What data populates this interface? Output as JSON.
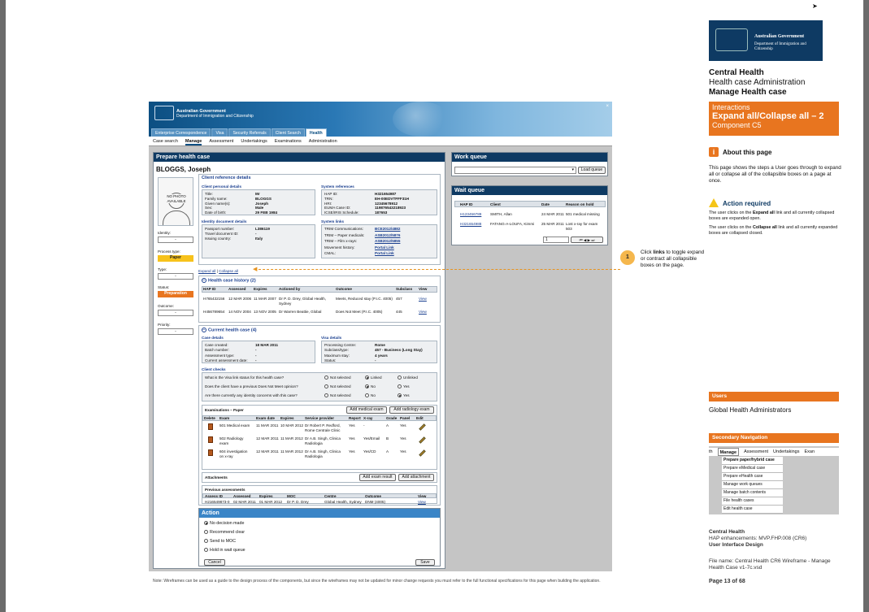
{
  "header": {
    "gov_line1": "Australian Government",
    "gov_line2": "Department of Immigration and Citizenship",
    "top_tabs": [
      "Enterprise Correspondence",
      "Visa",
      "Security Referrals",
      "Client Search",
      "Health"
    ],
    "sub_tabs": [
      "Case search",
      "Manage",
      "Assessment",
      "Undertakings",
      "Examinations",
      "Administration"
    ]
  },
  "prepare": {
    "title": "Prepare health case",
    "client_name": "BLOGGS, Joseph",
    "photo_text": "NO PHOTO AVAILABLE",
    "identity_label": "Identity:",
    "identity_value": "-",
    "process_type_label": "Process type:",
    "process_type_value": "Paper",
    "type_label": "Type:",
    "type_value": "-",
    "status_label": "Status:",
    "status_value": "Preparation",
    "outcome_label": "Outcome:",
    "outcome_value": "-",
    "priority_label": "Priority:",
    "priority_value": "-",
    "client_ref_title": "Client reference details",
    "client_personal_title": "Client personal details",
    "personal": [
      {
        "label": "Title:",
        "value": "Mr"
      },
      {
        "label": "Family name:",
        "value": "BLOGGS"
      },
      {
        "label": "Given name(s):",
        "value": "Joseph"
      },
      {
        "label": "Sex:",
        "value": "Male"
      },
      {
        "label": "Date of birth:",
        "value": "29 FEB 1984"
      }
    ],
    "system_ref_title": "System references",
    "system_refs": [
      {
        "label": "HAP ID:",
        "value": "H321654987"
      },
      {
        "label": "TRN:",
        "value": "EH-00EDVTFFF31H"
      },
      {
        "label": "HRI:",
        "value": "12345678912"
      },
      {
        "label": "EUMA Case ID:",
        "value": "119876543218923"
      },
      {
        "label": "ICSE/IRIS Schedule:",
        "value": "187653"
      }
    ],
    "identity_doc_title": "Identity document details",
    "identity_docs": [
      {
        "label": "Passport number:",
        "value": "L386119"
      },
      {
        "label": "Travel document ID:",
        "value": "-"
      },
      {
        "label": "Issuing country:",
        "value": "Italy"
      }
    ],
    "system_links_title": "System links",
    "system_links": [
      {
        "label": "TRIM Communications:",
        "value": "BCE2012/4882"
      },
      {
        "label": "TRIM – Paper medicals:",
        "value": "ASB2012/5876"
      },
      {
        "label": "TRIM – Film x-rays:",
        "value": "ASB2012/5855"
      },
      {
        "label": "Movement history:",
        "value": "Portal Link"
      },
      {
        "label": "CMAL:",
        "value": "Portal Link"
      }
    ],
    "expand_all": "Expand all",
    "collapse_all": "Collapse all",
    "history_title": "Health case history (2)",
    "history_cols": [
      "HAP ID",
      "Assessed",
      "Expires",
      "Actioned by",
      "Outcome",
      "Subclass",
      "View"
    ],
    "history_rows": [
      [
        "H765432156",
        "12 MAR 2006",
        "11 MAR 2007",
        "Dr P. D. Drey, Global Health, Sydney",
        "Meets, Reduced stay (P.I.C. 4005)",
        "457",
        "View"
      ],
      [
        "H456789654",
        "14 NOV 2004",
        "13 NOV 2005",
        "Dr Warren Beattie, Global",
        "Does Not Meet (P.I.C. 4005)",
        "445",
        "View"
      ]
    ],
    "current_title": "Current health case (4)",
    "case_details_title": "Case details",
    "case_details": [
      {
        "label": "Case created:",
        "value": "18 MAR 2011"
      },
      {
        "label": "Batch number:",
        "value": "-"
      },
      {
        "label": "Assessment type:",
        "value": "-"
      },
      {
        "label": "Current assessment date:",
        "value": "-"
      }
    ],
    "visa_details_title": "Visa details",
    "visa_details": [
      {
        "label": "Processing Centre:",
        "value": "Rome"
      },
      {
        "label": "Subclass/type:",
        "value": "457 - Business (Long Stay)"
      },
      {
        "label": "Maximum stay:",
        "value": "4 years"
      },
      {
        "label": "Status:",
        "value": "-"
      }
    ],
    "client_checks_title": "Client checks",
    "checks": [
      {
        "q": "What is the Visa link status for this health case?",
        "opts": [
          "Not selected",
          "Linked",
          "Unlinked"
        ],
        "sel": 1
      },
      {
        "q": "Does the client have a previous Does Not Meet opinion?",
        "opts": [
          "Not selected",
          "No",
          "Yes"
        ],
        "sel": 1
      },
      {
        "q": "Are there currently any identity concerns with this case?",
        "opts": [
          "Not selected",
          "No",
          "Yes"
        ],
        "sel": 2
      }
    ],
    "exams_title": "Examinations – Paper",
    "add_medical": "Add medical exam",
    "add_radiology": "Add radiology exam",
    "exam_cols": [
      "Delete",
      "Exam",
      "Exam date",
      "Expires",
      "Service provider",
      "Report",
      "X-ray",
      "Grade",
      "Panel",
      "Edit"
    ],
    "exam_rows": [
      [
        "501 Medical exam",
        "11 MAR 2011",
        "10 MAR 2012",
        "Dr Robert P. Redford, Rome Centrale Clinic",
        "Yes",
        "-",
        "A",
        "Yes"
      ],
      [
        "502 Radiology exam",
        "12 MAR 2011",
        "11 MAR 2012",
        "Dr A.B. Singh, Clinica Radiologia",
        "Yes",
        "Yes/Email",
        "B",
        "Yes"
      ],
      [
        "604 investigation on x-ray",
        "12 MAR 2011",
        "11 MAR 2012",
        "Dr A.B. Singh, Clinica Radiologia",
        "Yes",
        "Yes/CD",
        "A",
        "Yes"
      ]
    ],
    "attachments_title": "Attachments",
    "add_exam_result": "Add exam result",
    "add_attachment": "Add attachment",
    "prev_title": "Previous assessments",
    "prev_cols": [
      "Assess ID",
      "Assessed",
      "Expires",
      "MOC",
      "Centre",
      "Outcome",
      "View"
    ],
    "prev_rows": [
      [
        "H216549873-0",
        "02 MAR 2011",
        "01 MAR 2012",
        "Dr P. D. Drey",
        "Global Health, Sydney",
        "DNM (4005)",
        "View"
      ]
    ],
    "action_title": "Action",
    "action_options": [
      "No decision made",
      "Recommend clear",
      "Send to MOC",
      "Hold in wait queue"
    ],
    "action_selected": 0,
    "cancel": "Cancel",
    "save": "Save"
  },
  "work_queue": {
    "title": "Work queue",
    "load_button": "Load queue"
  },
  "wait_queue": {
    "title": "Wait queue",
    "cols": [
      "HAP ID",
      "Client",
      "Date",
      "Reason on hold"
    ],
    "rows": [
      [
        "H123456789",
        "SMITH, Allan",
        "24 MAR 2011",
        "501 medical missing"
      ],
      [
        "H321654988",
        "FATANG-A-LOUFA, Kimmi",
        "25 MAR 2011",
        "Lost x-ray for exam 503"
      ]
    ],
    "page": "1"
  },
  "callout": {
    "num": "1",
    "text": "Click links to toggle expand or contract all collapsible boxes on the page."
  },
  "note": "Note: Wireframes can be used as a guide to the design process of the components, but since the wireframes may not be updated for minor change requests you must refer to the full functional specifications for this page when building the application.",
  "right": {
    "logo_line1": "Australian Government",
    "logo_line2": "Department of Immigration and Citizenship",
    "title1": "Central Health",
    "title2": "Health case Administration",
    "title3": "Manage Health case",
    "interactions": "Interactions",
    "expand_title": "Expand all/Collapse all – 2",
    "component": "Component C5",
    "about_title": "About this page",
    "about_text": "This page shows the steps a User goes through to expand all or collapse all of the collapsible boxes on a page at once.",
    "action_req_title": "Action required",
    "action_req_1a": "The user clicks on the ",
    "action_req_1b": "Expand all",
    "action_req_1c": " link and all currently collapsed boxes are expanded open.",
    "action_req_2a": "The user clicks on the ",
    "action_req_2b": "Collapse all",
    "action_req_2c": " link and all currently expanded boxes are collapsed closed.",
    "users_title": "Users",
    "users_value": "Global Health Administrators",
    "sec_nav_title": "Secondary Navigation",
    "sec_tabs": [
      "th",
      "Manage",
      "Assessment",
      "Undertakings",
      "Exan"
    ],
    "sec_menu": [
      "Prepare paper/hybrid case",
      "Prepare eMedical case",
      "Prepare eHealth case",
      "Manage work queues",
      "Manage batch contents",
      "File health cases",
      "Edit health case"
    ],
    "footer1": "Central Health",
    "footer2": "HAP enhancements: MVP.FHP.008 (CR6)",
    "footer3": "User Interface Design",
    "footer4": "File name: Central Health CR6 Wireframe - Manage Health Case v1-7c.vsd",
    "footer5": "Page 13 of 68"
  }
}
